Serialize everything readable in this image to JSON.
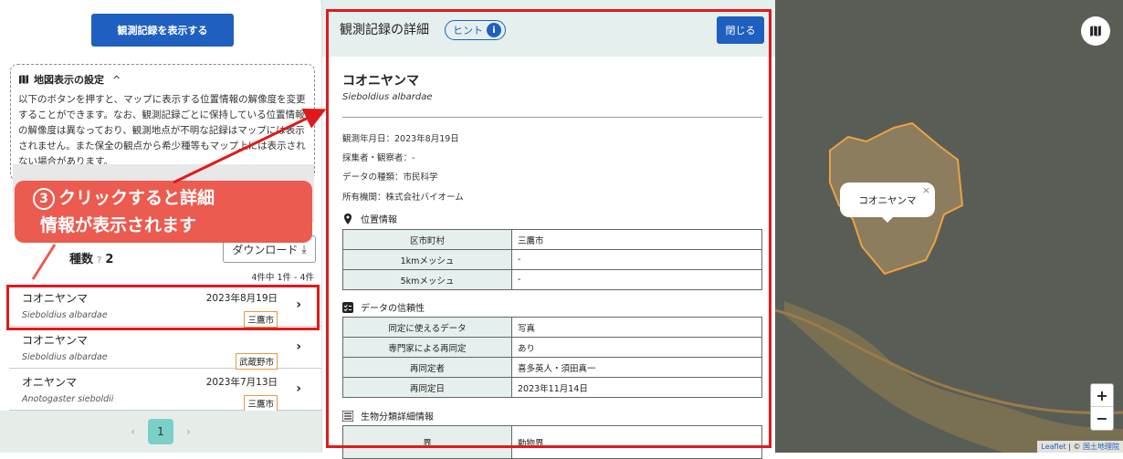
{
  "left": {
    "show_records_button": "観測記録を表示する",
    "settings_heading": "地図表示の設定",
    "settings_body": "以下のボタンを押すと、マップに表示する位置情報の解像度を変更することができます。なお、観測記録ごとに保持している位置情報の解像度は異なっており、観測地点が不明な記録はマップには表示されません。また保全の観点から希少種等もマップ上には表示されない場合があります。",
    "species_label": "種数",
    "species_count": "2",
    "download_label": "ダウンロード",
    "range_text": "4件中 1件 - 4件",
    "items": [
      {
        "name": "コオニヤンマ",
        "sci": "Sieboldius albardae",
        "date": "2023年8月19日",
        "location": "三鷹市"
      },
      {
        "name": "コオニヤンマ",
        "sci": "Sieboldius albardae",
        "date": "",
        "location": "武蔵野市"
      },
      {
        "name": "オニヤンマ",
        "sci": "Anotogaster sieboldii",
        "date": "2023年7月13日",
        "location": "三鷹市"
      }
    ],
    "pager": {
      "prev": "‹",
      "current": "1",
      "next": "›"
    }
  },
  "callout": {
    "number": "3",
    "line1": "クリックすると詳細",
    "line2": "情報が表示されます"
  },
  "detail": {
    "title": "観測記録の詳細",
    "hint_label": "ヒント",
    "close_label": "閉じる",
    "species_name": "コオニヤンマ",
    "species_sci": "Sieboldius albardae",
    "observed_date": "観測年月日：2023年8月19日",
    "collector": "採集者・観察者：-",
    "data_type": "データの種類：市民科学",
    "owner": "所有機関：株式会社バイオーム",
    "location_section": "位置情報",
    "location_rows": [
      [
        "区市町村",
        "三鷹市"
      ],
      [
        "1kmメッシュ",
        "-"
      ],
      [
        "5kmメッシュ",
        "-"
      ]
    ],
    "reliability_section": "データの信頼性",
    "reliability_rows": [
      [
        "同定に使えるデータ",
        "写真"
      ],
      [
        "専門家による再同定",
        "あり"
      ],
      [
        "再同定者",
        "喜多英人・須田真一"
      ],
      [
        "再同定日",
        "2023年11月14日"
      ]
    ],
    "taxonomy_section": "生物分類詳細情報",
    "taxonomy_rows": [
      [
        "界",
        "動物界"
      ]
    ]
  },
  "map": {
    "popup_label": "コオニヤンマ",
    "zoom_in": "+",
    "zoom_out": "−",
    "attribution_leaflet": "Leaflet",
    "attribution_sep": "| ©",
    "attribution_gsi": "国土地理院"
  }
}
